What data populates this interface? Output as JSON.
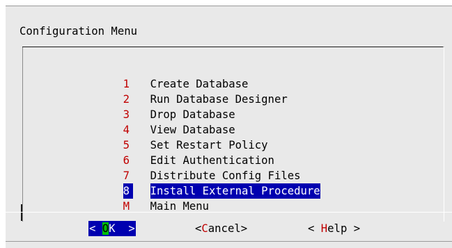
{
  "dialog": {
    "title": "Configuration Menu"
  },
  "menu": {
    "items": [
      {
        "key": "1",
        "label": "Create Database"
      },
      {
        "key": "2",
        "label": "Run Database Designer"
      },
      {
        "key": "3",
        "label": "Drop Database"
      },
      {
        "key": "4",
        "label": "View Database"
      },
      {
        "key": "5",
        "label": "Set Restart Policy"
      },
      {
        "key": "6",
        "label": "Edit Authentication"
      },
      {
        "key": "7",
        "label": "Distribute Config Files"
      },
      {
        "key": "8",
        "label": "Install External Procedure"
      },
      {
        "key": "M",
        "label": "Main Menu"
      }
    ],
    "selected_key": "8"
  },
  "buttons": {
    "ok": {
      "open": "< ",
      "hotkey": "O",
      "rest": "K  >"
    },
    "cancel": {
      "open": "<",
      "hotkey": "C",
      "rest": "ancel>"
    },
    "help": {
      "open": "< ",
      "hotkey": "H",
      "rest": "elp >"
    }
  },
  "colors": {
    "selection_bg": "#0000b0",
    "hotkey": "#c00000",
    "ok_hotkey_bg": "#00c000",
    "dialog_bg": "#e9e9e9"
  }
}
